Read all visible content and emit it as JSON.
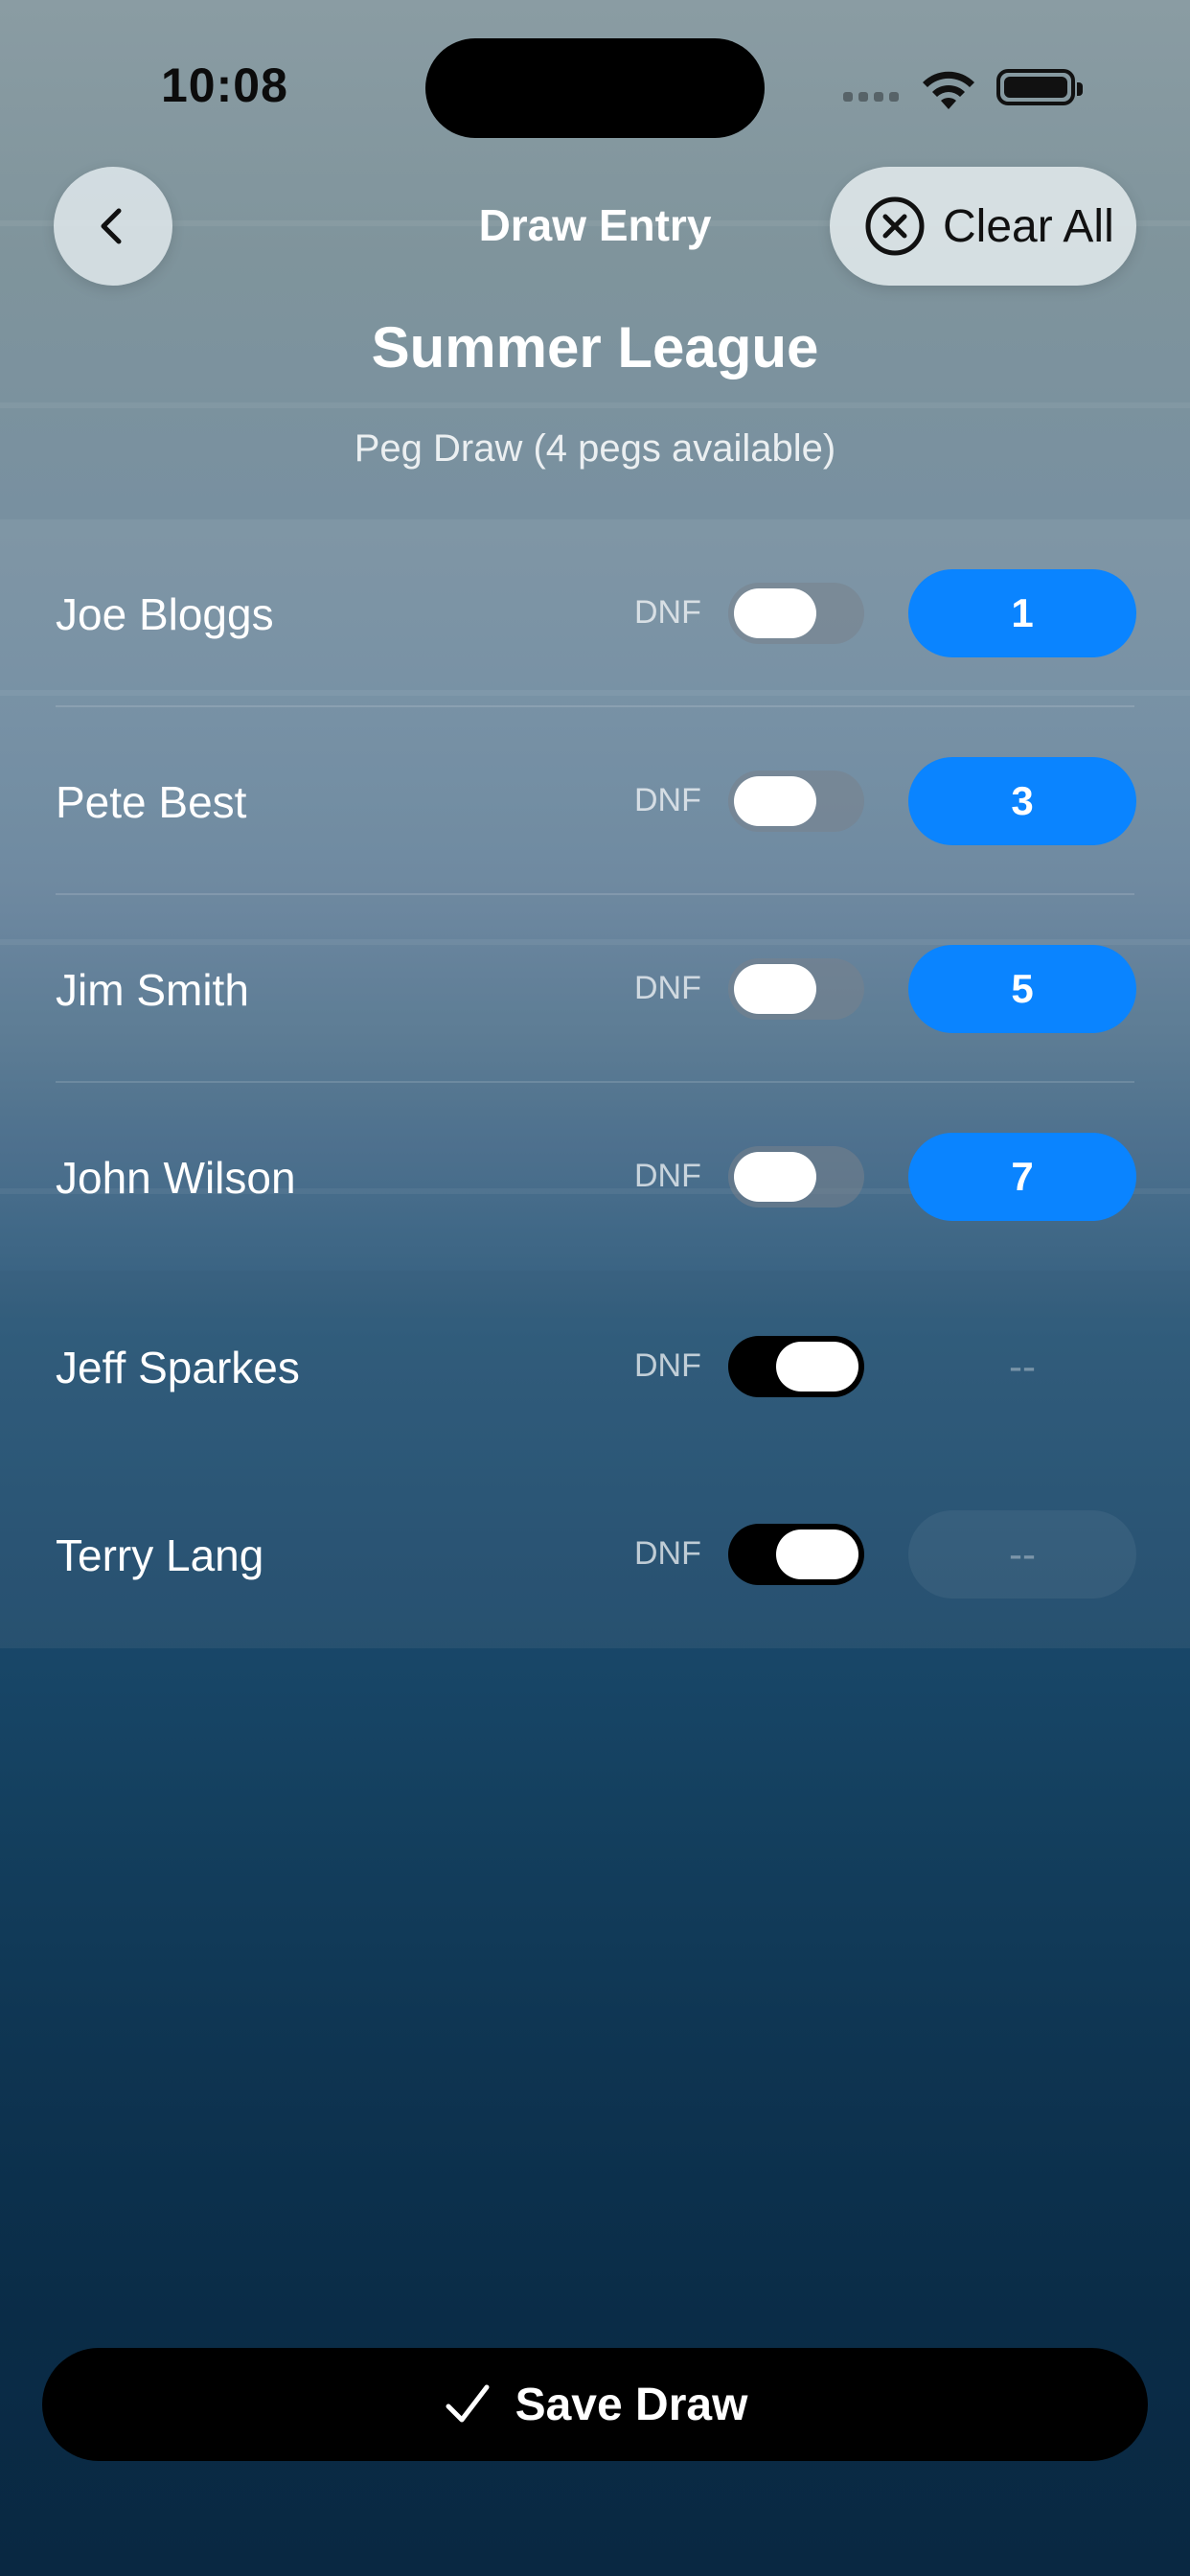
{
  "status_bar": {
    "time": "10:08"
  },
  "nav": {
    "back_icon": "chevron-left-icon",
    "title": "Draw Entry",
    "clear_label": "Clear All",
    "clear_icon": "x-circle-icon"
  },
  "header": {
    "league": "Summer League",
    "subtitle": "Peg Draw (4 pegs available)"
  },
  "rows": [
    {
      "name": "Joe Bloggs",
      "dnf_label": "DNF",
      "dnf": false,
      "peg": "1"
    },
    {
      "name": "Pete Best",
      "dnf_label": "DNF",
      "dnf": false,
      "peg": "3"
    },
    {
      "name": "Jim Smith",
      "dnf_label": "DNF",
      "dnf": false,
      "peg": "5"
    },
    {
      "name": "John Wilson",
      "dnf_label": "DNF",
      "dnf": false,
      "peg": "7"
    },
    {
      "name": "Jeff Sparkes",
      "dnf_label": "DNF",
      "dnf": true,
      "peg": "--"
    },
    {
      "name": "Terry Lang",
      "dnf_label": "DNF",
      "dnf": true,
      "peg": "--"
    }
  ],
  "footer": {
    "save_label": "Save Draw",
    "save_icon": "checkmark-icon"
  },
  "colors": {
    "accent": "#0A84FF",
    "button_dark": "#000000"
  }
}
